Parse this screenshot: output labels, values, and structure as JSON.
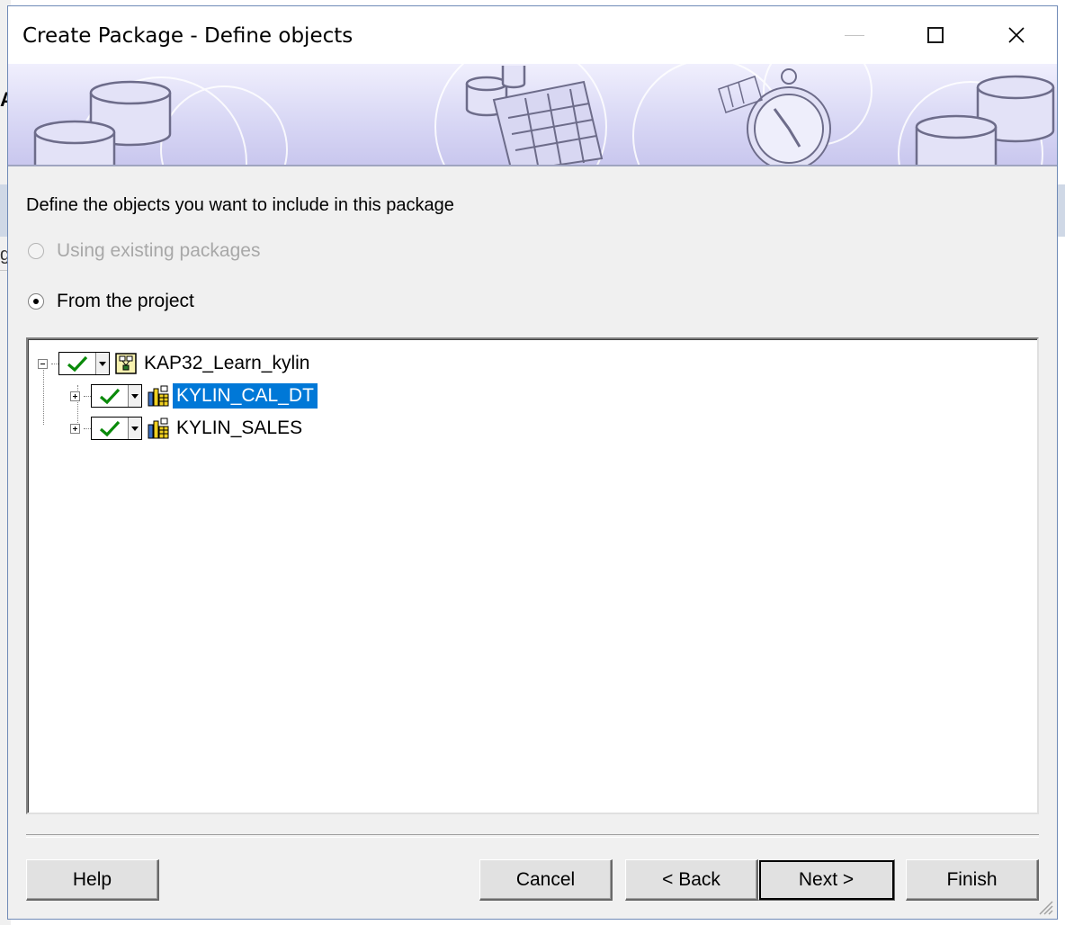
{
  "background": {
    "glyph_top": "A",
    "glyph_mid": "g"
  },
  "window": {
    "title": "Create Package - Define objects",
    "minimize_label": "minimize",
    "maximize_label": "maximize",
    "close_label": "close"
  },
  "instructions": "Define the objects you want to include in this package",
  "options": {
    "existing": {
      "label": "Using existing packages",
      "checked": false,
      "enabled": false
    },
    "project": {
      "label": "From the project",
      "checked": true,
      "enabled": true
    }
  },
  "tree": {
    "root": {
      "label": "KAP32_Learn_kylin",
      "checked": true,
      "expanded": true
    },
    "children": [
      {
        "label": "KYLIN_CAL_DT",
        "checked": true,
        "expanded": false,
        "selected": true
      },
      {
        "label": "KYLIN_SALES",
        "checked": true,
        "expanded": false,
        "selected": false
      }
    ]
  },
  "buttons": {
    "help": "Help",
    "cancel": "Cancel",
    "back": "< Back",
    "next": "Next >",
    "finish": "Finish"
  },
  "colors": {
    "selection": "#0078d7",
    "check": "#0a8a0a",
    "banner": "#d9d8f5"
  },
  "icons": {
    "check": "check-icon",
    "project": "project-icon",
    "table": "table-icon"
  }
}
